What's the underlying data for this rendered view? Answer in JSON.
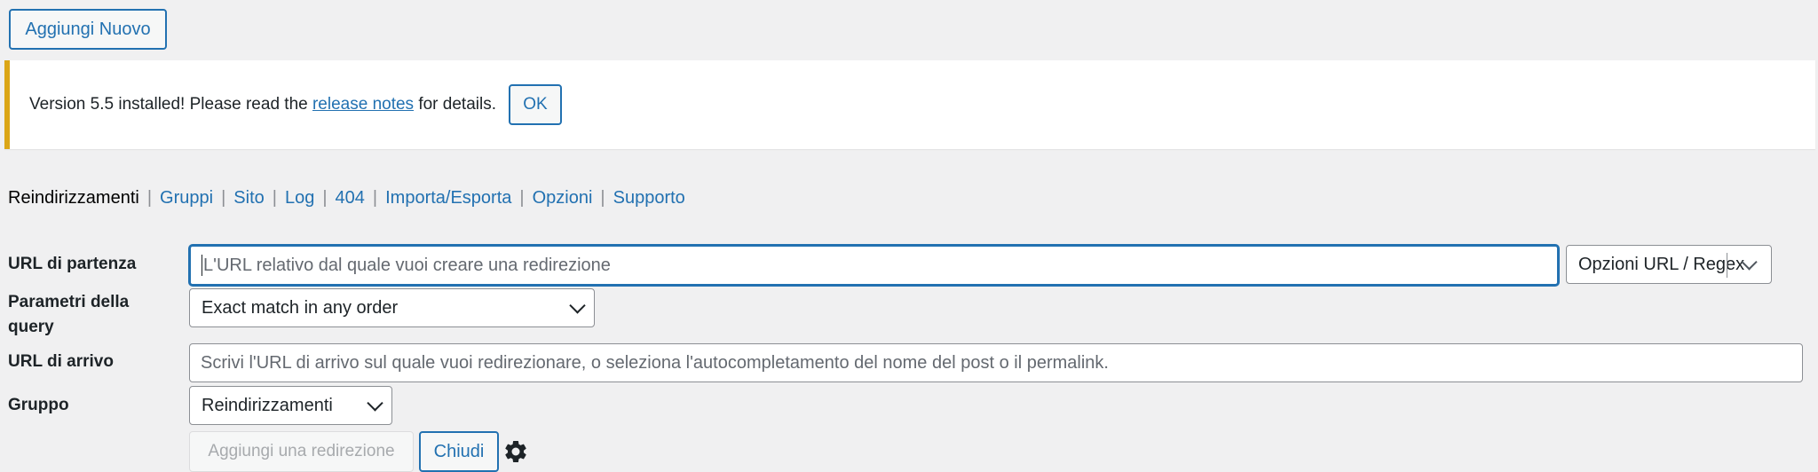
{
  "toolbar": {
    "add_new_label": "Aggiungi Nuovo"
  },
  "notice": {
    "text_before": "Version 5.5 installed! Please read the ",
    "link_text": "release notes",
    "text_after": " for details.",
    "ok_label": "OK",
    "accent_color": "#dba617"
  },
  "subnav": {
    "current": "Reindirizzamenti",
    "separator": "|",
    "items": [
      "Gruppi",
      "Sito",
      "Log",
      "404",
      "Importa/Esporta",
      "Opzioni",
      "Supporto"
    ]
  },
  "form": {
    "source_label": "URL di partenza",
    "source_placeholder": "L'URL relativo dal quale vuoi creare una redirezione",
    "url_options_label": "Opzioni URL / Regex",
    "query_label": "Parametri della query",
    "query_value": "Exact match in any order",
    "target_label": "URL di arrivo",
    "target_placeholder": "Scrivi l'URL di arrivo sul quale vuoi redirezionare, o seleziona l'autocompletamento del nome del post o il permalink.",
    "group_label": "Gruppo",
    "group_value": "Reindirizzamenti",
    "add_button_label": "Aggiungi una redirezione",
    "close_button_label": "Chiudi",
    "settings_icon": "gear-icon"
  },
  "colors": {
    "accent": "#2271b1",
    "background": "#f0f0f1"
  }
}
